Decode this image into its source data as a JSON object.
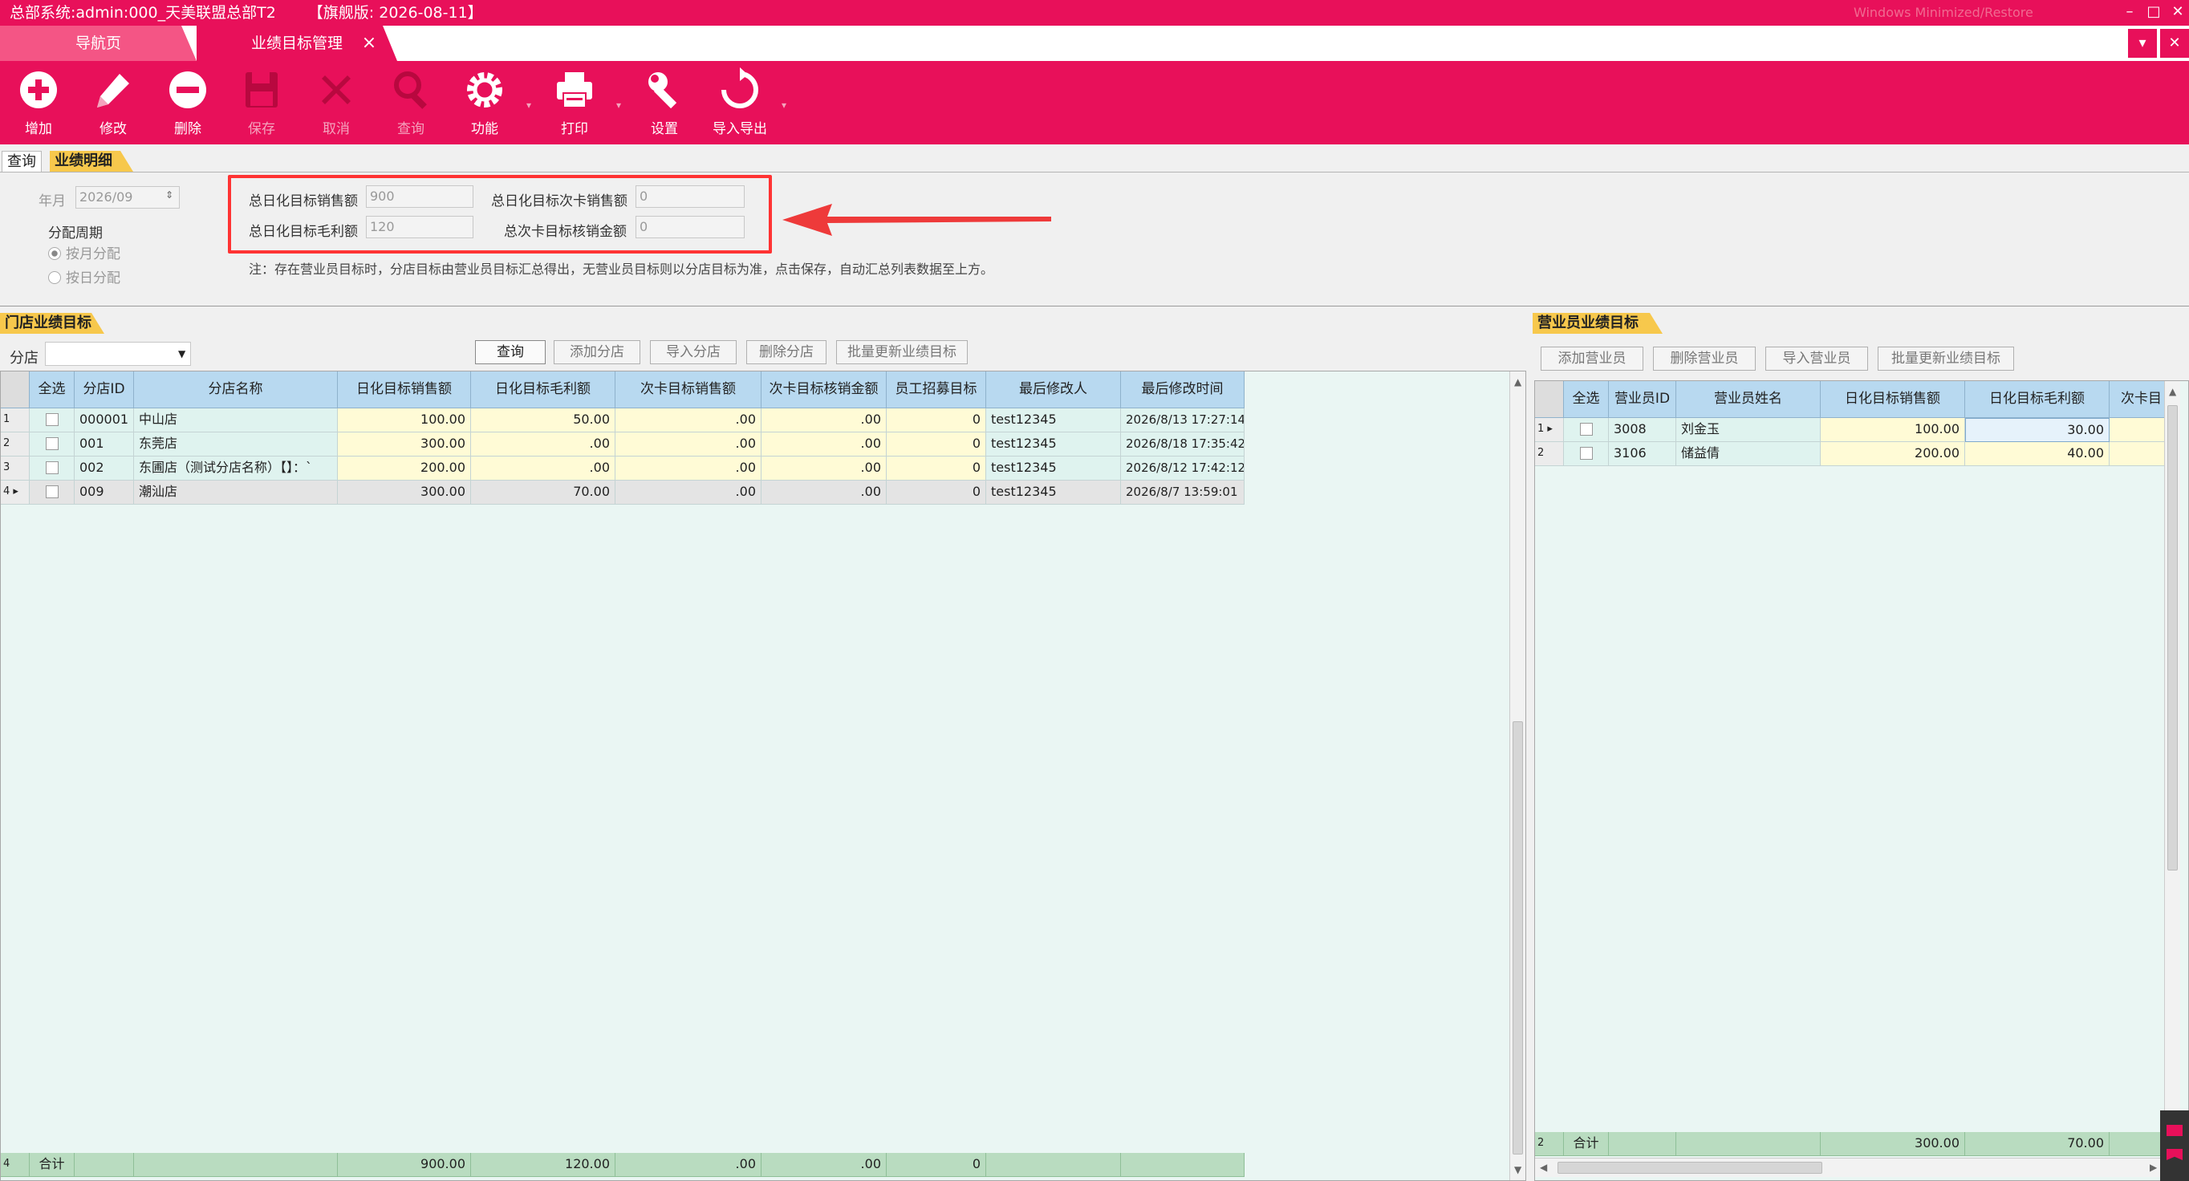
{
  "window": {
    "title": "总部系统:admin:000_天美联盟总部T2",
    "version": "【旗舰版: 2026-08-11】",
    "faint_text": "Windows Minimized/Restore"
  },
  "tabs": {
    "nav_label": "导航页",
    "active_label": "业绩目标管理"
  },
  "toolbar": {
    "add": "增加",
    "edit": "修改",
    "delete": "删除",
    "save": "保存",
    "cancel": "取消",
    "query": "查询",
    "function": "功能",
    "print": "打印",
    "settings": "设置",
    "import_export": "导入导出"
  },
  "subtabs": {
    "query": "查询",
    "detail": "业绩明细"
  },
  "form": {
    "year_month_label": "年月",
    "year_month_value": "2026/09",
    "period_label": "分配周期",
    "by_month": "按月分配",
    "by_day": "按日分配",
    "total_sales_label": "总日化目标销售额",
    "total_sales_value": "900",
    "total_card_sales_label": "总日化目标次卡销售额",
    "total_card_sales_value": "0",
    "total_margin_label": "总日化目标毛利额",
    "total_margin_value": "120",
    "total_card_writeoff_label": "总次卡目标核销金额",
    "total_card_writeoff_value": "0",
    "note": "注：存在营业员目标时，分店目标由营业员目标汇总得出，无营业员目标则以分店目标为准，点击保存，自动汇总列表数据至上方。"
  },
  "store_panel": {
    "title": "门店业绩目标",
    "branch_label": "分店",
    "buttons": {
      "query": "查询",
      "add": "添加分店",
      "import": "导入分店",
      "delete": "删除分店",
      "batch": "批量更新业绩目标"
    },
    "columns": [
      "全选",
      "分店ID",
      "分店名称",
      "日化目标销售额",
      "日化目标毛利额",
      "次卡目标销售额",
      "次卡目标核销金额",
      "员工招募目标",
      "最后修改人",
      "最后修改时间"
    ],
    "rows": [
      {
        "n": "1",
        "id": "000001",
        "name": "中山店",
        "sales": "100.00",
        "margin": "50.00",
        "card": ".00",
        "writeoff": ".00",
        "recruit": "0",
        "modifier": "test12345",
        "time": "2026/8/13 17:27:14"
      },
      {
        "n": "2",
        "id": "001",
        "name": "东莞店",
        "sales": "300.00",
        "margin": ".00",
        "card": ".00",
        "writeoff": ".00",
        "recruit": "0",
        "modifier": "test12345",
        "time": "2026/8/18 17:35:42"
      },
      {
        "n": "3",
        "id": "002",
        "name": "东圃店（测试分店名称）【】：`",
        "sales": "200.00",
        "margin": ".00",
        "card": ".00",
        "writeoff": ".00",
        "recruit": "0",
        "modifier": "test12345",
        "time": "2026/8/12 17:42:12"
      },
      {
        "n": "4",
        "id": "009",
        "name": "潮汕店",
        "sales": "300.00",
        "margin": "70.00",
        "card": ".00",
        "writeoff": ".00",
        "recruit": "0",
        "modifier": "test12345",
        "time": "2026/8/7 13:59:01"
      }
    ],
    "total": {
      "n": "4",
      "label": "合计",
      "sales": "900.00",
      "margin": "120.00",
      "card": ".00",
      "writeoff": ".00",
      "recruit": "0"
    }
  },
  "staff_panel": {
    "title": "营业员业绩目标",
    "buttons": {
      "add": "添加营业员",
      "delete": "删除营业员",
      "import": "导入营业员",
      "batch": "批量更新业绩目标"
    },
    "columns": [
      "全选",
      "营业员ID",
      "营业员姓名",
      "日化目标销售额",
      "日化目标毛利额",
      "次卡目"
    ],
    "rows": [
      {
        "n": "1",
        "id": "3008",
        "name": "刘金玉",
        "sales": "100.00",
        "margin": "30.00"
      },
      {
        "n": "2",
        "id": "3106",
        "name": "储益倩",
        "sales": "200.00",
        "margin": "40.00"
      }
    ],
    "total": {
      "n": "2",
      "label": "合计",
      "sales": "300.00",
      "margin": "70.00"
    }
  }
}
